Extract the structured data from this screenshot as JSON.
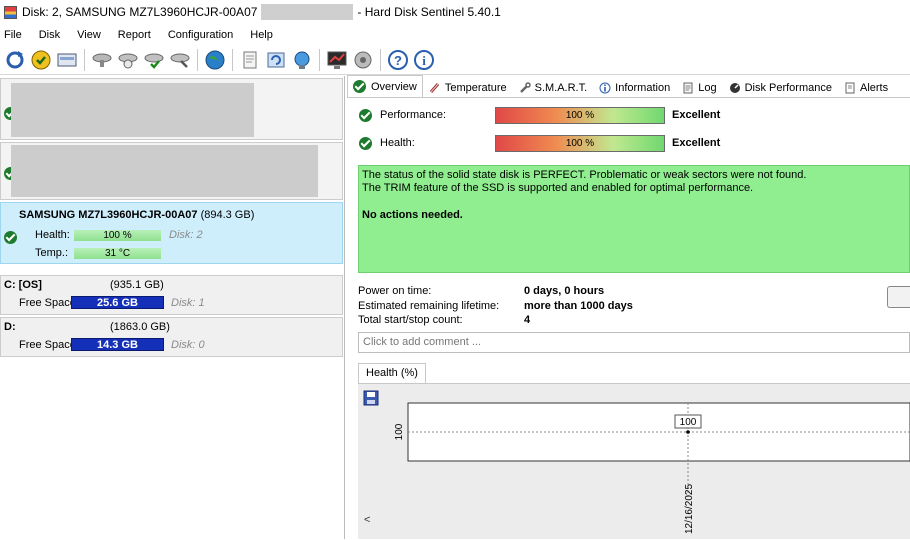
{
  "window": {
    "title_prefix": "Disk: 2, SAMSUNG MZ7L3960HCJR-00A07",
    "title_suffix": "- Hard Disk Sentinel 5.40.1"
  },
  "menu": [
    {
      "label": "File"
    },
    {
      "label": "Disk"
    },
    {
      "label": "View"
    },
    {
      "label": "Report"
    },
    {
      "label": "Configuration"
    },
    {
      "label": "Help"
    }
  ],
  "toolbar_icons": [
    "refresh-icon",
    "alert-icon",
    "disk-drive-icon",
    "hdd-tool-icon",
    "hdd-test-icon",
    "hdd-check-icon",
    "hdd-repair-icon",
    "globe-icon",
    "report-icon",
    "sync-icon",
    "network-icon",
    "performance-icon",
    "sound-icon",
    "help-icon",
    "info-icon"
  ],
  "left_panel": {
    "selected_disk": {
      "name": "SAMSUNG MZ7L3960HCJR-00A07",
      "size": "(894.3 GB)",
      "health_label": "Health:",
      "health_value": "100 %",
      "health_fraction": 1.0,
      "disk_label": "Disk: 2",
      "temp_label": "Temp.:",
      "temp_value": "31 °C"
    },
    "volumes": [
      {
        "name": "C: [OS]",
        "size": "(935.1 GB)",
        "free_label": "Free Space",
        "free_value": "25.6 GB",
        "disk": "Disk: 1"
      },
      {
        "name": "D:",
        "size": "(1863.0 GB)",
        "free_label": "Free Space",
        "free_value": "14.3 GB",
        "disk": "Disk: 0"
      }
    ]
  },
  "tabs": [
    {
      "label": "Overview",
      "icon": "check-icon",
      "active": true
    },
    {
      "label": "Temperature",
      "icon": "thermometer-icon"
    },
    {
      "label": "S.M.A.R.T.",
      "icon": "wrench-icon"
    },
    {
      "label": "Information",
      "icon": "info-icon"
    },
    {
      "label": "Log",
      "icon": "log-icon"
    },
    {
      "label": "Disk Performance",
      "icon": "performance-icon"
    },
    {
      "label": "Alerts",
      "icon": "alerts-icon"
    }
  ],
  "overview": {
    "performance_label": "Performance:",
    "performance_value": "100 %",
    "performance_rating": "Excellent",
    "health_label": "Health:",
    "health_value": "100 %",
    "health_rating": "Excellent",
    "status_line1": "The status of the solid state disk is PERFECT. Problematic or weak sectors were not found.",
    "status_line2": "The TRIM feature of the SSD is supported and enabled for optimal performance.",
    "status_action": "No actions needed.",
    "power_on_label": "Power on time:",
    "power_on_value": "0 days, 0 hours",
    "lifetime_label": "Estimated remaining lifetime:",
    "lifetime_value": "more than 1000 days",
    "startstop_label": "Total start/stop count:",
    "startstop_value": "4",
    "comment_placeholder": "Click to add comment ..."
  },
  "chart_tab": "Health (%)",
  "chart_data": {
    "type": "line",
    "x": [
      "12/16/2025"
    ],
    "series": [
      {
        "values": [
          100
        ]
      }
    ],
    "ylabel": "100",
    "data_label": "100",
    "grid": true
  },
  "scroll_label": "<"
}
